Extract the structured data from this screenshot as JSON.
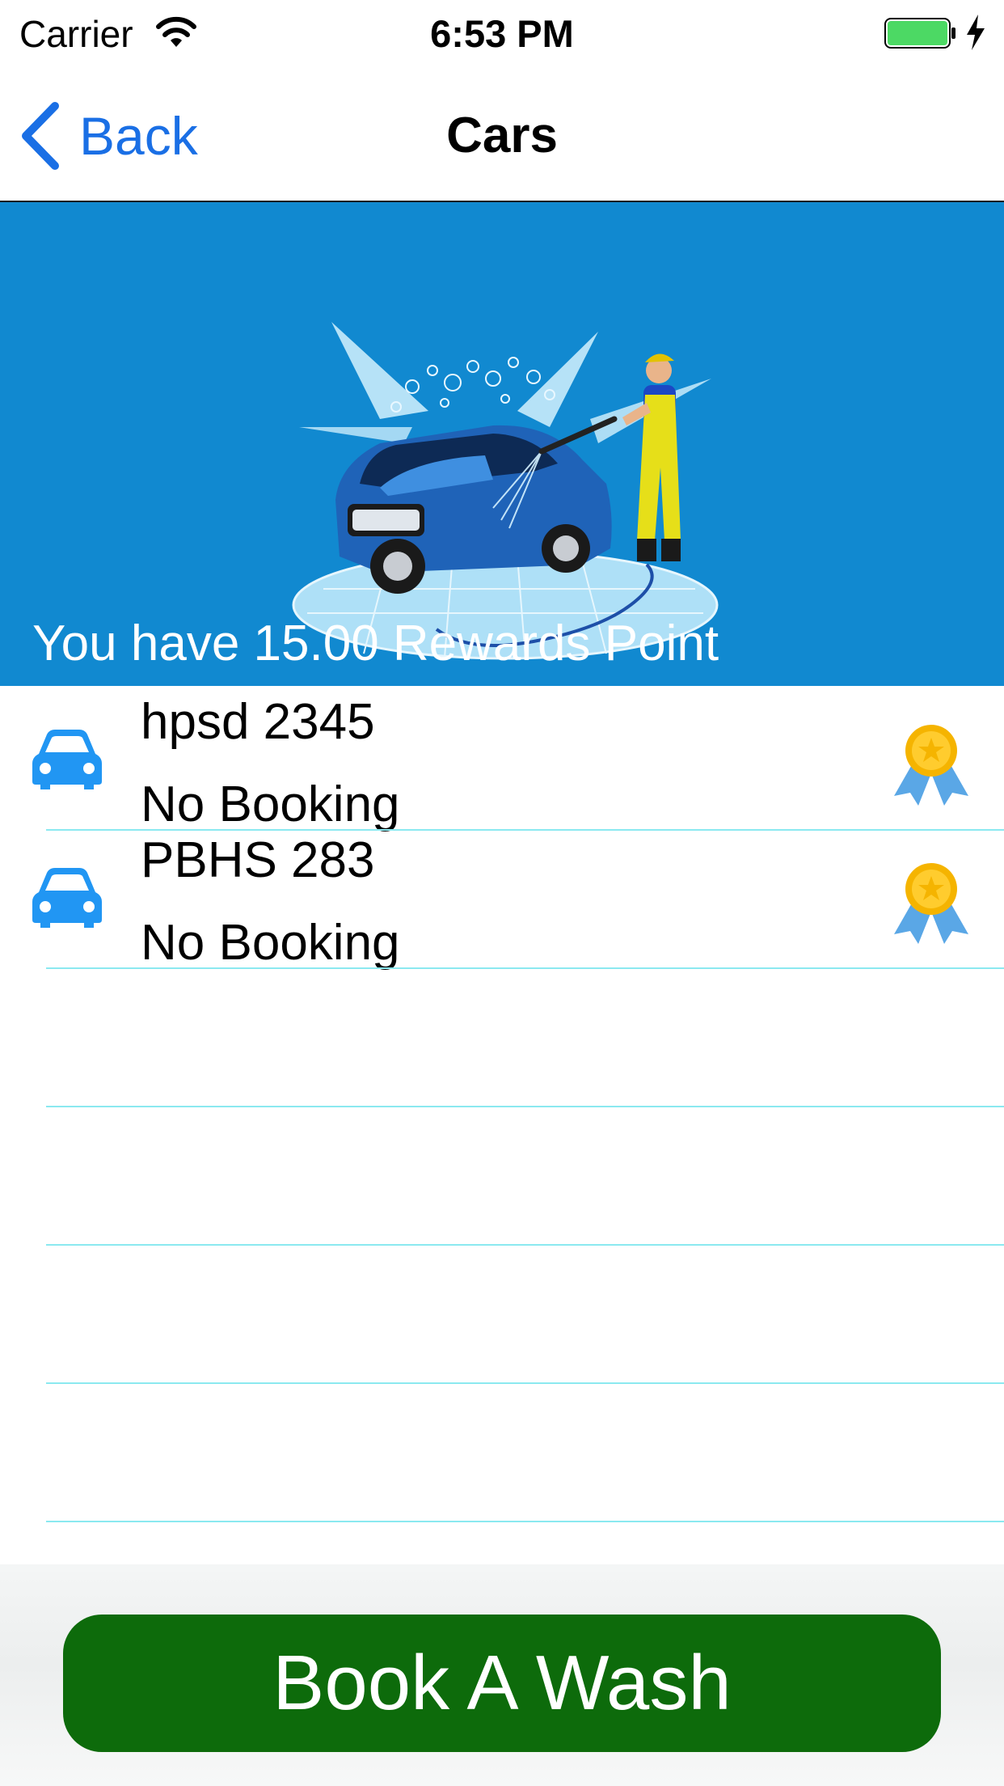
{
  "status_bar": {
    "carrier": "Carrier",
    "time": "6:53 PM",
    "icons": [
      "wifi-icon",
      "battery-icon",
      "charging-bolt-icon"
    ]
  },
  "nav": {
    "back_label": "Back",
    "title": "Cars"
  },
  "hero": {
    "illustration": "car-wash-illustration",
    "rewards_text": "You have 15.00 Rewards Point"
  },
  "cars": [
    {
      "plate": "hpsd 2345",
      "status": "No Booking",
      "icon": "car-icon",
      "badge": "medal-icon"
    },
    {
      "plate": "PBHS 283",
      "status": "No Booking",
      "icon": "car-icon",
      "badge": "medal-icon"
    }
  ],
  "footer": {
    "button_label": "Book A Wash"
  },
  "colors": {
    "accent": "#1a6fe5",
    "hero_bg": "#1189d0",
    "separator": "#8be9f0",
    "button_bg": "#0d6b0b"
  }
}
